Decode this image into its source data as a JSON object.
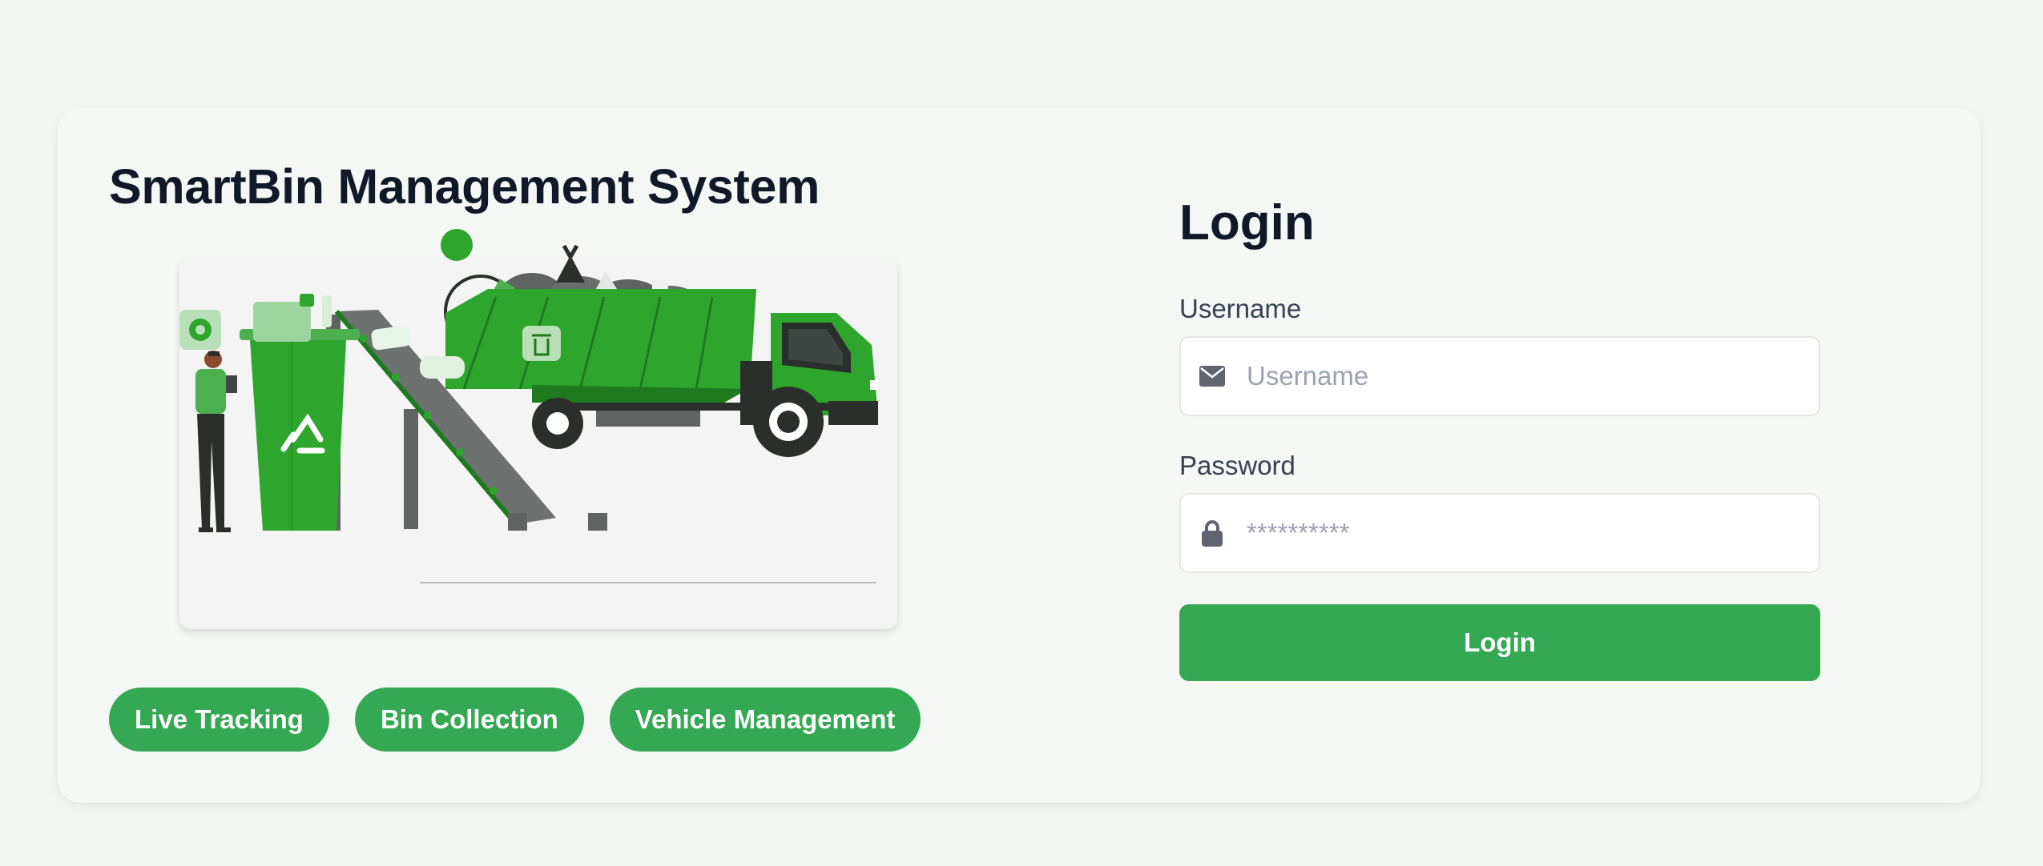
{
  "app": {
    "title": "SmartBin Management System"
  },
  "features": [
    {
      "label": "Live Tracking"
    },
    {
      "label": "Bin Collection"
    },
    {
      "label": "Vehicle Management"
    }
  ],
  "login": {
    "title": "Login",
    "username": {
      "label": "Username",
      "placeholder": "Username",
      "value": "",
      "icon": "envelope-icon"
    },
    "password": {
      "label": "Password",
      "placeholder": "**********",
      "value": "",
      "icon": "lock-icon"
    },
    "submit_label": "Login"
  },
  "colors": {
    "accent": "#34a853",
    "illustration_green": "#2ea62e",
    "text_dark": "#111827",
    "background": "#f4f6f4"
  }
}
